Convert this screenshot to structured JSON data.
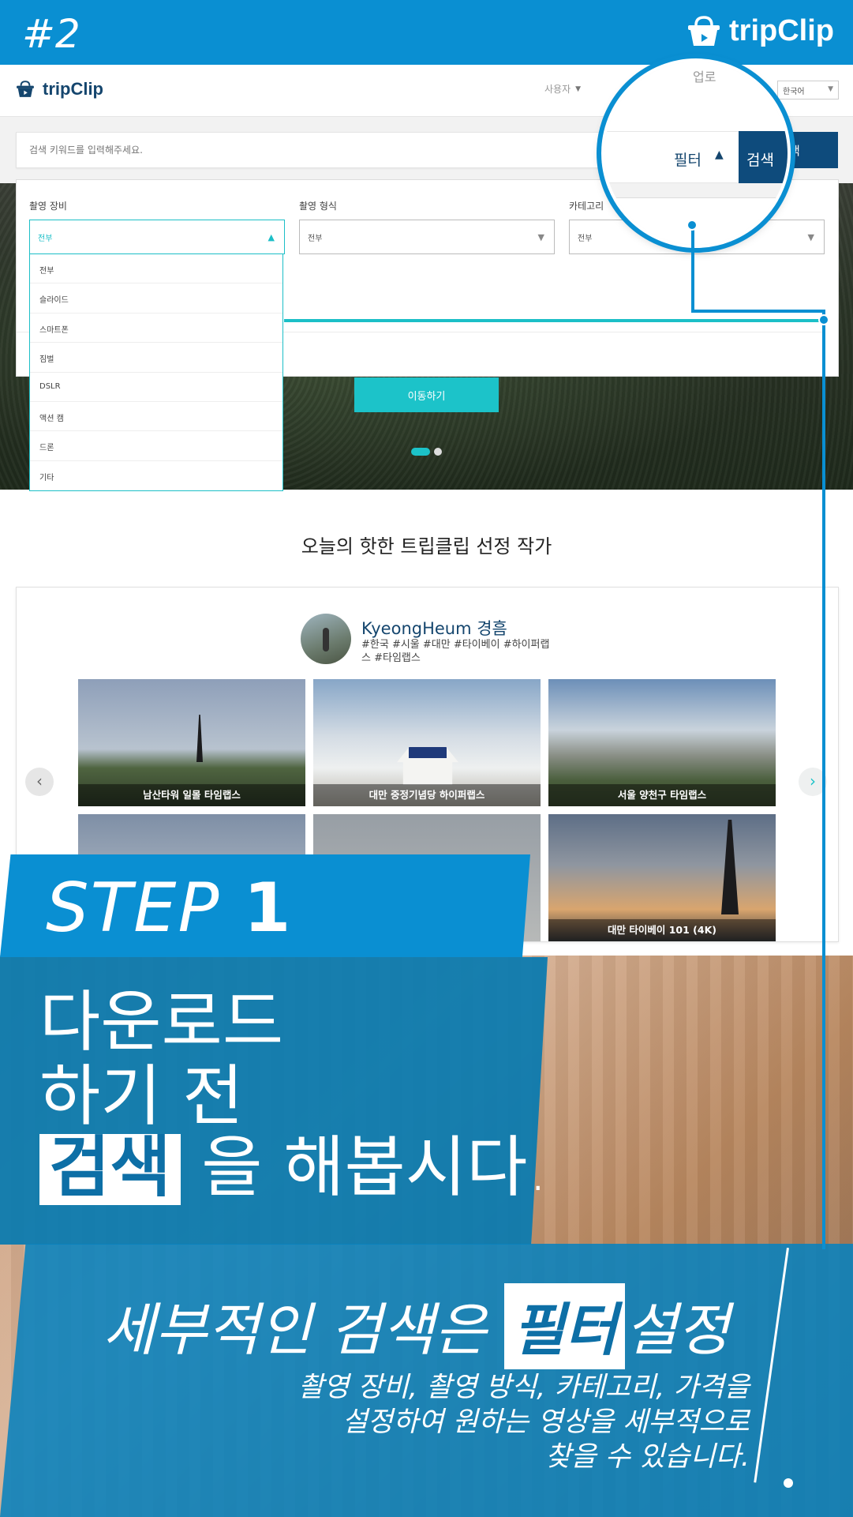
{
  "banner": {
    "number": "#2",
    "brand": "tripClip"
  },
  "navbar": {
    "brand": "tripClip",
    "menu_item_1": "사용자",
    "language": "한국어"
  },
  "search": {
    "placeholder": "검색 키워드를 입력해주세요.",
    "button_label": "검색"
  },
  "filters": {
    "equipment": {
      "label": "촬영 장비",
      "selected": "전부"
    },
    "format": {
      "label": "촬영 형식",
      "selected": "전부"
    },
    "category": {
      "label": "카테고리",
      "selected": "전부"
    },
    "equipment_options": [
      "전부",
      "슬라이드",
      "스마트폰",
      "짐벌",
      "DSLR",
      "액션 캠",
      "드론",
      "기타"
    ]
  },
  "hero": {
    "move_button": "이동하기"
  },
  "featured": {
    "title": "오늘의 핫한 트립클립 선정 작가",
    "artist_name": "KyeongHeum 경흠",
    "artist_tags": "#한국 #시울 #대만 #타이베이 #하이퍼랩스 #타임랩스",
    "videos": [
      "남산타워 일몰 타임랩스",
      "대만 중정기념당 하이퍼랩스",
      "서울 양천구 타임랩스",
      "",
      "",
      "대만 타이베이 101 (4K)"
    ]
  },
  "magnifier": {
    "top_text": "업로",
    "filter_label": "필터",
    "search_label": "검색"
  },
  "promo": {
    "step_word": "STEP",
    "step_number": "1",
    "heading_line1": "다운로드",
    "heading_line2": "하기 전",
    "heading_highlight": "검색",
    "heading_rest": "을 해봅시다.",
    "filter_heading_pre": "세부적인 검색은",
    "filter_heading_highlight": "필터",
    "filter_heading_post": "설정",
    "description_line1": "촬영 장비, 촬영 방식, 카테고리, 가격을",
    "description_line2": "설정하여 원하는 영상을 세부적으로",
    "description_line3": "찾을 수 있습니다."
  },
  "colors": {
    "brand_blue": "#0a8fd2",
    "navy": "#0e4b7c",
    "teal": "#1cc3c9"
  }
}
